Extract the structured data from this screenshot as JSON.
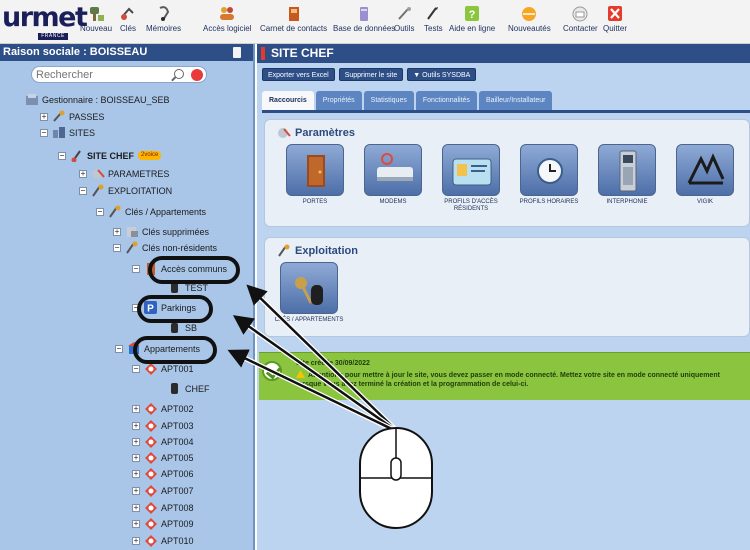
{
  "brand": {
    "logo_text": "urmet",
    "logo_tag": "FRANCE"
  },
  "toolbar": {
    "items": [
      {
        "label": "Nouveau",
        "icon": "new-key-icon"
      },
      {
        "label": "Clés",
        "icon": "keys-icon"
      },
      {
        "label": "Mémoires",
        "icon": "memory-icon"
      },
      {
        "label": "Accès logiciel",
        "icon": "users-icon"
      },
      {
        "label": "Carnet de contacts",
        "icon": "contacts-book-icon"
      },
      {
        "label": "Base de données",
        "icon": "database-icon"
      },
      {
        "label": "Outils",
        "icon": "tools-icon"
      },
      {
        "label": "Tests",
        "icon": "tests-icon"
      },
      {
        "label": "Aide en ligne",
        "icon": "help-icon"
      },
      {
        "label": "Nouveautés",
        "icon": "news-icon"
      },
      {
        "label": "Contacter",
        "icon": "contact-icon"
      },
      {
        "label": "Quitter",
        "icon": "quit-icon"
      }
    ]
  },
  "left": {
    "title": "Raison sociale : BOISSEAU",
    "search_placeholder": "Rechercher",
    "tree": [
      {
        "label": "Gestionnaire : BOISSEAU_SEB",
        "icon": "manager-icon"
      },
      {
        "label": "PASSES",
        "icon": "master-key-icon"
      },
      {
        "label": "SITES",
        "icon": "sites-icon"
      },
      {
        "label": "SITE CHEF",
        "icon": "site-icon",
        "badge": "2voice"
      },
      {
        "label": "PARAMETRES",
        "icon": "settings-icon"
      },
      {
        "label": "EXPLOITATION",
        "icon": "operation-icon"
      },
      {
        "label": "Clés / Appartements",
        "icon": "keys-apartments-icon"
      },
      {
        "label": "Clés supprimées",
        "icon": "deleted-keys-icon"
      },
      {
        "label": "Clés non-résidents",
        "icon": "non-resident-keys-icon"
      },
      {
        "label": "Accès communs",
        "icon": "common-access-icon"
      },
      {
        "label": "TEST",
        "icon": "key-fob-icon"
      },
      {
        "label": "Parkings",
        "icon": "parking-icon"
      },
      {
        "label": "SB",
        "icon": "key-fob-icon"
      },
      {
        "label": "Appartements",
        "icon": "apartments-icon"
      },
      {
        "label": "APT001",
        "icon": "apartment-icon"
      },
      {
        "label": "CHEF",
        "icon": "key-fob-icon"
      },
      {
        "label": "APT002",
        "icon": "apartment-icon"
      },
      {
        "label": "APT003",
        "icon": "apartment-icon"
      },
      {
        "label": "APT004",
        "icon": "apartment-icon"
      },
      {
        "label": "APT005",
        "icon": "apartment-icon"
      },
      {
        "label": "APT006",
        "icon": "apartment-icon"
      },
      {
        "label": "APT007",
        "icon": "apartment-icon"
      },
      {
        "label": "APT008",
        "icon": "apartment-icon"
      },
      {
        "label": "APT009",
        "icon": "apartment-icon"
      },
      {
        "label": "APT010",
        "icon": "apartment-icon"
      }
    ]
  },
  "right": {
    "title": "SITE CHEF",
    "actions": [
      "Exporter vers Excel",
      "Supprimer le site",
      "Outils SYSDBA"
    ],
    "tabs": [
      "Raccourcis",
      "Propriétés",
      "Statistiques",
      "Fonctionnalités",
      "Bailleur/Installateur"
    ],
    "active_tab": "Raccourcis",
    "params_title": "Paramètres",
    "params_tiles": [
      "Portes",
      "Modems",
      "Profils d'accès Résidents",
      "Profils horaires",
      "Interphonie",
      "VIGIK"
    ],
    "exploit_title": "Exploitation",
    "exploit_tiles": [
      "Clés / Appartements"
    ],
    "notice_line1": "Site créé le 30/09/2022",
    "notice_line2": "Attention : pour mettre à jour le site, vous devez passer en mode connecté. Mettez votre site en mode connecté uniquement lorsque vous avez terminé la création et la programmation de celui-ci."
  },
  "colors": {
    "header_blue": "#2d4e86",
    "panel_blue": "#a9c6e8",
    "notice_green": "#8bc53f",
    "accent_red": "#e23a2c"
  }
}
